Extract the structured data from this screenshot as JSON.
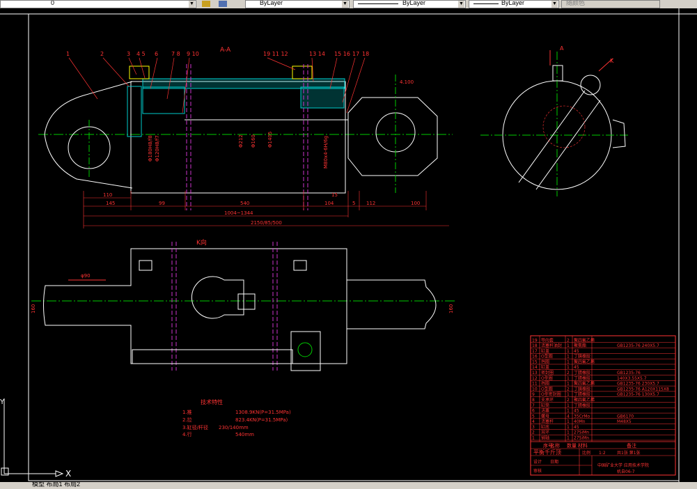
{
  "toolbar": {
    "layer_combo_value": "0",
    "color_combo_value": "ByLayer",
    "linetype_combo_value": "ByLayer",
    "lineweight_combo_value": "ByLayer",
    "plotstyle_combo_value": "随颜色"
  },
  "colors": {
    "background": "#000000",
    "frame": "#ffffff",
    "part_annotation": "#ff3333",
    "centerline": "#00cc00",
    "hatch": "#00cccc",
    "yellow": "#ffff00",
    "hidden_line": "#cc33cc"
  },
  "drawing": {
    "section_label": "A-A",
    "view_label_k": "K向",
    "view_label_a": "A",
    "view_label_k_small": "K",
    "part_numbers": [
      "1",
      "2",
      "3",
      "4",
      "5",
      "6",
      "7",
      "8",
      "9",
      "10",
      "11",
      "12",
      "13",
      "14",
      "15",
      "16",
      "17",
      "18"
    ],
    "part_numbers_left": {
      "p1": "1",
      "p2": "2",
      "p3": "3",
      "p45": "4 5",
      "p6": "6",
      "p78": "7 8",
      "p910": "9 10"
    },
    "part_numbers_right": {
      "p19": "19 11 12",
      "p1314": "13 14",
      "p1516": "15 16",
      "p17": "17",
      "p18": "18"
    },
    "dimensions": {
      "d110": "110",
      "d145": "145",
      "d99": "99",
      "d540": "540",
      "d104": "104",
      "d15": "15",
      "d5": "5",
      "d112": "112",
      "d100": "100",
      "d1004": "1004~1344",
      "d2150": "2150/85/500",
      "d90": "φ90",
      "d4100": "4.100",
      "v1": "Φ180H8/f8",
      "v2": "Φ120H8/f7",
      "v3": "Φ212",
      "v4": "Φ160",
      "v5": "Φ1405",
      "v6": "M80x4-6H/6g",
      "d_k": "φ90",
      "d_k_left": "160",
      "d_k_right": "160"
    }
  },
  "tech_notes": {
    "title": "技术特性",
    "rows": [
      {
        "label": "1.推",
        "value": "1308.9KN(P=31.5MPa)"
      },
      {
        "label": "2.拉",
        "value": "823.4KN(P=31.5MPa)"
      },
      {
        "label": "3.缸径/杆径",
        "value": "230/140mm"
      },
      {
        "label": "4.行",
        "value": "540mm"
      }
    ]
  },
  "bom": {
    "rows": [
      {
        "no": "19",
        "name": "导向套",
        "qty": "2",
        "material": "聚四氟乙烯",
        "std": ""
      },
      {
        "no": "18",
        "name": "活塞杆油封",
        "qty": "1",
        "material": "聚氨酯",
        "std": "GB1235-76 240X5.7"
      },
      {
        "no": "17",
        "name": "缸盖",
        "qty": "1",
        "material": "45",
        "std": ""
      },
      {
        "no": "16",
        "name": "O型圈",
        "qty": "1",
        "material": "丁腈橡胶",
        "std": ""
      },
      {
        "no": "15",
        "name": "挡圈",
        "qty": "1",
        "material": "聚四氟乙烯",
        "std": ""
      },
      {
        "no": "14",
        "name": "缸盖",
        "qty": "1",
        "material": "45",
        "std": ""
      },
      {
        "no": "13",
        "name": "密封圈",
        "qty": "2",
        "material": "丁腈橡胶",
        "std": "GB1235-76"
      },
      {
        "no": "12",
        "name": "O型圈",
        "qty": "1",
        "material": "丁腈橡胶",
        "std": "140X3.55X5.7"
      },
      {
        "no": "11",
        "name": "挡圈",
        "qty": "1",
        "material": "聚四氟乙烯",
        "std": "GB1235-76 230X5.7"
      },
      {
        "no": "10",
        "name": "O型圈",
        "qty": "2",
        "material": "丁腈橡胶",
        "std": "GB1235-76 A120X115X8"
      },
      {
        "no": "9",
        "name": "O型密封圈",
        "qty": "1",
        "material": "丁腈橡胶",
        "std": "GB1235-76 130X5.7"
      },
      {
        "no": "8",
        "name": "支承环",
        "qty": "2",
        "material": "聚四氟乙烯",
        "std": ""
      },
      {
        "no": "7",
        "name": "缸筒",
        "qty": "1",
        "material": "丁腈橡胶",
        "std": ""
      },
      {
        "no": "6",
        "name": "活塞",
        "qty": "1",
        "material": "45",
        "std": ""
      },
      {
        "no": "5",
        "name": "螺母",
        "qty": "4",
        "material": "35CrMo",
        "std": "GB6170"
      },
      {
        "no": "4",
        "name": "活塞杆",
        "qty": "1",
        "material": "40Mn",
        "std": "M48X5"
      },
      {
        "no": "3",
        "name": "缸底",
        "qty": "1",
        "material": "45",
        "std": ""
      },
      {
        "no": "2",
        "name": "耳环",
        "qty": "1",
        "material": "27SiMn",
        "std": ""
      },
      {
        "no": "1",
        "name": "销轴",
        "qty": "1",
        "material": "27SiMn",
        "std": ""
      }
    ],
    "header": {
      "no": "序号",
      "name": "名称",
      "qty": "数量",
      "material": "材料",
      "std": "备注"
    },
    "title_block": {
      "drawing_title": "平衡千斤顶",
      "scale_label": "比例",
      "scale_value": "1:2",
      "sheet": "共1张 第1张",
      "design_label": "设计",
      "check_label": "审核",
      "date_label": "日期",
      "school": "中国矿业大学 应用技术学院",
      "class": "机自06-7"
    }
  },
  "ucs": {
    "x_label": "X",
    "y_label": "Y"
  },
  "status": {
    "text": "模型 布局1 布局2"
  }
}
